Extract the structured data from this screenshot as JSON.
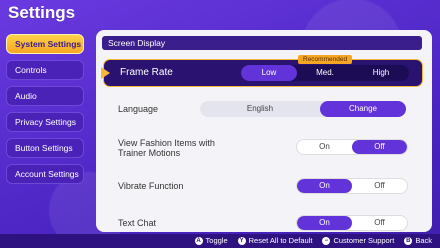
{
  "title": "Settings",
  "sidebar": {
    "items": [
      {
        "label": "System Settings"
      },
      {
        "label": "Controls"
      },
      {
        "label": "Audio"
      },
      {
        "label": "Privacy Settings"
      },
      {
        "label": "Button Settings"
      },
      {
        "label": "Account Settings"
      }
    ]
  },
  "panel": {
    "header": "Screen Display",
    "frame_rate": {
      "label": "Frame Rate",
      "badge": "Recommended",
      "options": [
        "Low",
        "Med.",
        "High"
      ],
      "selected": "Low"
    },
    "language": {
      "label": "Language",
      "value": "English",
      "button": "Change"
    },
    "fashion": {
      "label_line1": "View Fashion Items with",
      "label_line2": "Trainer Motions",
      "on": "On",
      "off": "Off",
      "selected": "Off"
    },
    "vibrate": {
      "label": "Vibrate Function",
      "on": "On",
      "off": "Off",
      "selected": "On"
    },
    "text_chat": {
      "label": "Text Chat",
      "on": "On",
      "off": "Off",
      "selected": "On"
    }
  },
  "footer": {
    "hints": [
      {
        "glyph": "A",
        "label": "Toggle"
      },
      {
        "glyph": "Y",
        "label": "Reset All to Default"
      },
      {
        "glyph": "−",
        "label": "Customer Support"
      },
      {
        "glyph": "B",
        "label": "Back"
      }
    ]
  },
  "colors": {
    "background": "#5b2fd6",
    "accent": "#6233d8",
    "highlight": "#f5a623"
  }
}
